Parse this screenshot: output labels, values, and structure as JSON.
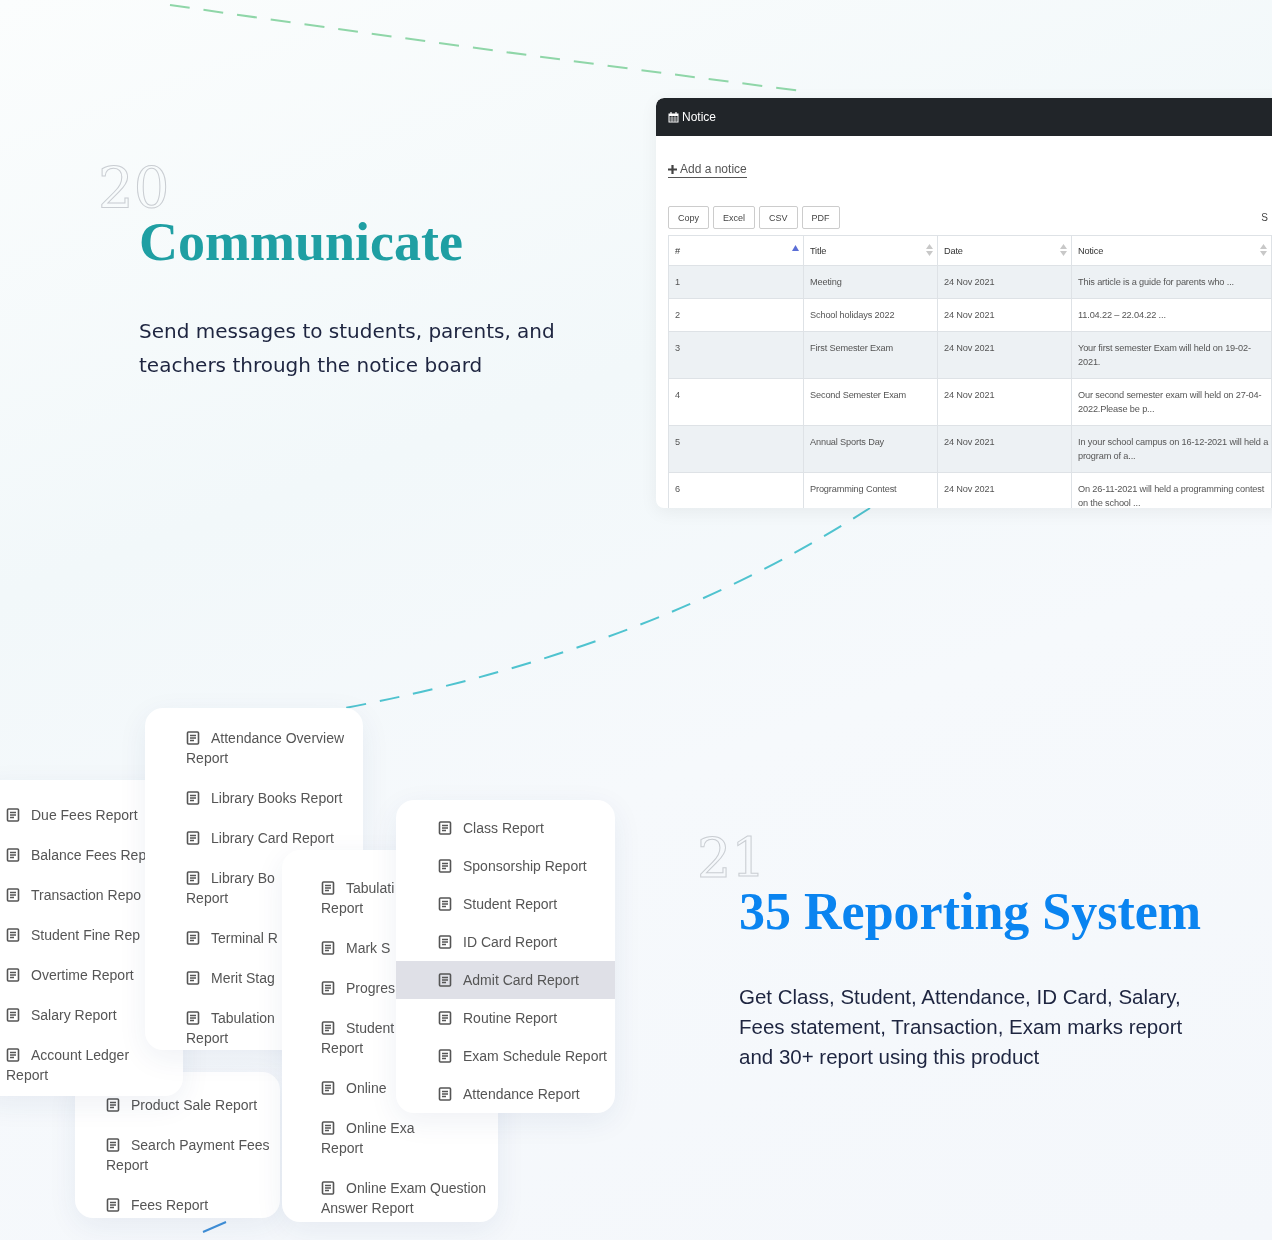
{
  "communicate": {
    "number": "20",
    "title": "Communicate",
    "description": "Send messages to students, parents, and teachers through the notice board"
  },
  "notice_panel": {
    "title": "Notice",
    "add_link": "Add a notice",
    "export_buttons": [
      "Copy",
      "Excel",
      "CSV",
      "PDF"
    ],
    "search_label": "S",
    "columns": [
      {
        "label": "#",
        "sorted": true
      },
      {
        "label": "Title",
        "sorted": false
      },
      {
        "label": "Date",
        "sorted": false
      },
      {
        "label": "Notice",
        "sorted": false
      }
    ],
    "rows": [
      {
        "cells": [
          "1",
          "Meeting",
          "24 Nov 2021",
          "This article is a guide for parents who ..."
        ]
      },
      {
        "cells": [
          "2",
          "School holidays 2022",
          "24 Nov 2021",
          "11.04.22 – 22.04.22 ..."
        ]
      },
      {
        "cells": [
          "3",
          "First Semester Exam",
          "24 Nov 2021",
          "Your first semester Exam will held on 19-02-2021."
        ]
      },
      {
        "cells": [
          "4",
          "Second Semester Exam",
          "24 Nov 2021",
          "Our second semester exam will held on 27-04-2022.Please be p..."
        ]
      },
      {
        "cells": [
          "5",
          "Annual Sports Day",
          "24 Nov 2021",
          "In your school campus on 16-12-2021 will held a program of a..."
        ]
      },
      {
        "cells": [
          "6",
          "Programming Contest",
          "24 Nov 2021",
          "On 26-11-2021 will held a programming contest on the school ..."
        ]
      }
    ]
  },
  "report_menus": [
    {
      "items": [
        {
          "lines": [
            "Product Sale Report"
          ],
          "selected": false
        },
        {
          "lines": [
            "Search Payment Fees",
            "Report"
          ],
          "selected": false
        },
        {
          "lines": [
            "Fees Report"
          ],
          "selected": false
        }
      ]
    },
    {
      "items": [
        {
          "lines": [
            "Due Fees Report"
          ],
          "selected": false
        },
        {
          "lines": [
            "Balance Fees Rep"
          ],
          "selected": false
        },
        {
          "lines": [
            "Transaction Repo"
          ],
          "selected": false
        },
        {
          "lines": [
            "Student Fine Rep"
          ],
          "selected": false
        },
        {
          "lines": [
            "Overtime Report"
          ],
          "selected": false
        },
        {
          "lines": [
            "Salary Report"
          ],
          "selected": false
        },
        {
          "lines": [
            "Account Ledger",
            "Report"
          ],
          "selected": false
        }
      ]
    },
    {
      "items": [
        {
          "lines": [
            "Attendance Overview",
            "Report"
          ],
          "selected": false
        },
        {
          "lines": [
            "Library Books Report"
          ],
          "selected": false
        },
        {
          "lines": [
            "Library Card Report"
          ],
          "selected": false
        },
        {
          "lines": [
            "Library Bo",
            "Report"
          ],
          "selected": false
        },
        {
          "lines": [
            "Terminal R"
          ],
          "selected": false
        },
        {
          "lines": [
            "Merit Stag"
          ],
          "selected": false
        },
        {
          "lines": [
            "Tabulation",
            "Report"
          ],
          "selected": false
        }
      ]
    },
    {
      "items": [
        {
          "lines": [
            "Tabulati",
            "Report"
          ],
          "selected": false
        },
        {
          "lines": [
            "Mark S"
          ],
          "selected": false
        },
        {
          "lines": [
            "Progres"
          ],
          "selected": false
        },
        {
          "lines": [
            "Student",
            "Report"
          ],
          "selected": false
        },
        {
          "lines": [
            "Online"
          ],
          "selected": false
        },
        {
          "lines": [
            "Online Exa",
            "Report"
          ],
          "selected": false
        },
        {
          "lines": [
            "Online Exam Question",
            "Answer Report"
          ],
          "selected": false
        }
      ]
    },
    {
      "items": [
        {
          "lines": [
            "Class Report"
          ],
          "selected": false
        },
        {
          "lines": [
            "Sponsorship Report"
          ],
          "selected": false
        },
        {
          "lines": [
            "Student Report"
          ],
          "selected": false
        },
        {
          "lines": [
            "ID Card Report"
          ],
          "selected": false
        },
        {
          "lines": [
            "Admit Card Report"
          ],
          "selected": true
        },
        {
          "lines": [
            "Routine Report"
          ],
          "selected": false
        },
        {
          "lines": [
            "Exam Schedule Report"
          ],
          "selected": false
        },
        {
          "lines": [
            "Attendance Report"
          ],
          "selected": false
        }
      ]
    }
  ],
  "reporting": {
    "number": "21",
    "title": "35 Reporting System",
    "description": "Get Class, Student, Attendance, ID Card, Salary, Fees statement, Transaction, Exam marks report and 30+ report using this product"
  }
}
